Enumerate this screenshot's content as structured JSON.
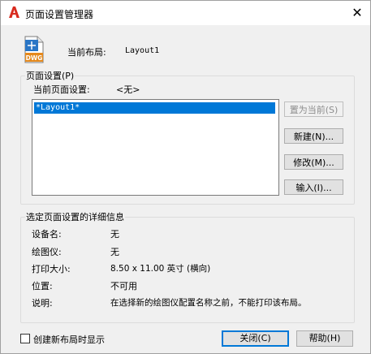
{
  "window": {
    "title": "页面设置管理器",
    "close_glyph": "✕"
  },
  "header": {
    "icon_text": "DWG",
    "current_layout_label": "当前布局:",
    "current_layout_value": "Layout1"
  },
  "page_setups": {
    "group_label": "页面设置(P)",
    "current_label": "当前页面设置:",
    "current_value": "<无>",
    "list": [
      "*Layout1*"
    ],
    "buttons": {
      "set_current": "置为当前(S)",
      "new": "新建(N)...",
      "modify": "修改(M)...",
      "import": "输入(I)..."
    }
  },
  "details": {
    "group_label": "选定页面设置的详细信息",
    "rows": [
      {
        "label": "设备名:",
        "value": "无"
      },
      {
        "label": "绘图仪:",
        "value": "无"
      },
      {
        "label": "打印大小:",
        "value": "8.50 x 11.00 英寸 (横向)"
      },
      {
        "label": "位置:",
        "value": "不可用"
      },
      {
        "label": "说明:",
        "value": "在选择新的绘图仪配置名称之前，不能打印该布局。"
      }
    ]
  },
  "footer": {
    "checkbox_label": "创建新布局时显示",
    "checkbox_checked": false,
    "close_button": "关闭(C)",
    "help_button": "帮助(H)"
  }
}
